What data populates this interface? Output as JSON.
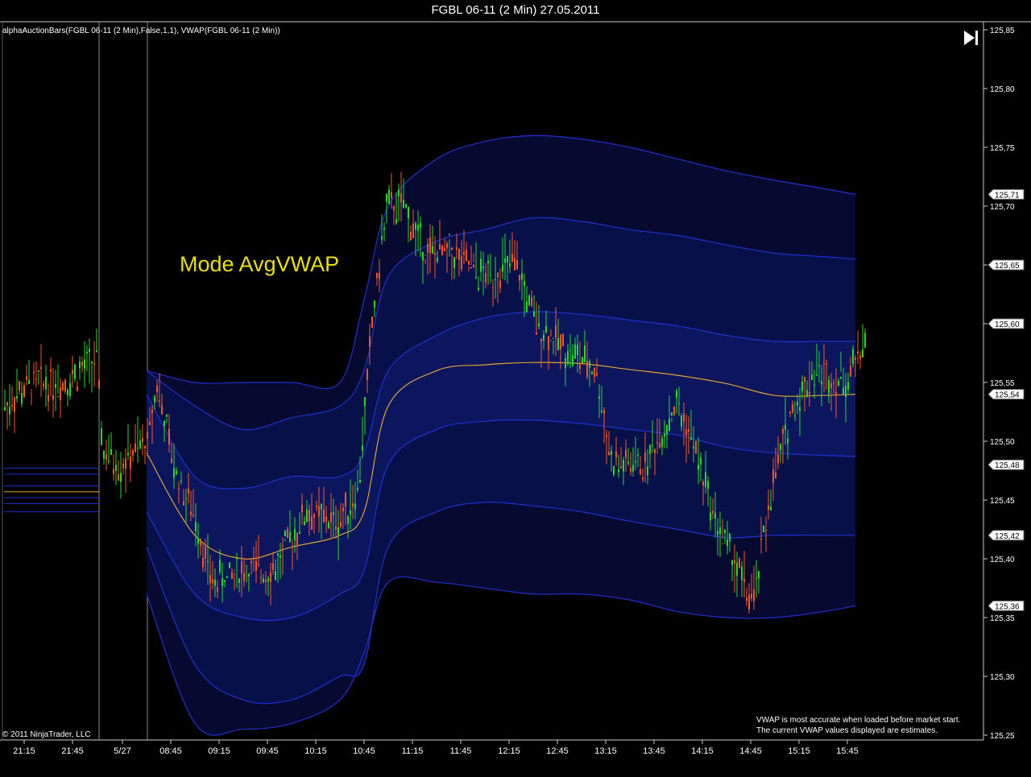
{
  "window": {
    "title": "FGBL 06-11 (2 Min)  27.05.2011",
    "indicator_label": "alphaAuctionBars(FGBL 06-11 (2 Min),False,1,1), VWAP(FGBL 06-11 (2 Min))",
    "annotation": "Mode AvgVWAP",
    "copyright": "© 2011 NinjaTrader, LLC",
    "notice_line1": "VWAP is most accurate when loaded before market start.",
    "notice_line2": "The current VWAP values displayed are estimates.",
    "play_icon": "skip-to-end-icon"
  },
  "colors": {
    "background": "#000000",
    "annotation": "#e8e000",
    "vwap": "#e0a030",
    "band": "#2030d0",
    "up_bar": "#22dd22",
    "down_bar": "#ff5522",
    "neutral_bar": "#ffffff",
    "session_fill": "#0a1060"
  },
  "chart_data": {
    "type": "line",
    "y_axis": {
      "range": [
        125.25,
        125.85
      ],
      "ticks": [
        "125,85",
        "125,80",
        "125,75",
        "125,70",
        "125,65",
        "125,60",
        "125,55",
        "125,50",
        "125,45",
        "125,40",
        "125,35",
        "125,30",
        "125,25"
      ]
    },
    "x_axis": {
      "ticks": [
        "21:15",
        "21:45",
        "5/27",
        "08:45",
        "09:15",
        "09:45",
        "10:15",
        "10:45",
        "11:15",
        "11:45",
        "12:15",
        "12:45",
        "13:15",
        "13:45",
        "14:15",
        "14:45",
        "15:15",
        "15:45"
      ]
    },
    "price_flags": [
      {
        "label": "125,71",
        "value": 125.71
      },
      {
        "label": "125,65",
        "value": 125.65
      },
      {
        "label": "125,60",
        "value": 125.6
      },
      {
        "label": "125,54",
        "value": 125.54
      },
      {
        "label": "125,48",
        "value": 125.48
      },
      {
        "label": "125,42",
        "value": 125.42
      },
      {
        "label": "125,36",
        "value": 125.36
      }
    ],
    "series": [
      {
        "name": "VWAP",
        "x": [
          "08:30",
          "09:00",
          "09:30",
          "10:00",
          "10:30",
          "10:45",
          "11:00",
          "11:30",
          "12:00",
          "12:30",
          "13:00",
          "13:30",
          "14:00",
          "14:30",
          "15:00",
          "15:30",
          "15:50"
        ],
        "values": [
          125.49,
          125.42,
          125.4,
          125.41,
          125.42,
          125.44,
          125.53,
          125.56,
          125.565,
          125.567,
          125.566,
          125.561,
          125.556,
          125.549,
          125.539,
          125.539,
          125.54
        ]
      },
      {
        "x": [
          "08:30",
          "09:00",
          "09:30",
          "10:00",
          "10:30",
          "10:45",
          "11:00",
          "11:30",
          "12:00",
          "12:30",
          "13:00",
          "13:30",
          "14:00",
          "14:30",
          "15:00",
          "15:30",
          "15:50"
        ],
        "values": [
          125.54,
          125.47,
          125.46,
          125.47,
          125.47,
          125.49,
          125.56,
          125.59,
          125.605,
          125.61,
          125.608,
          125.603,
          125.598,
          125.59,
          125.585,
          125.585,
          125.585
        ]
      },
      {
        "x": [
          "08:30",
          "09:00",
          "09:30",
          "10:00",
          "10:30",
          "10:45",
          "11:00",
          "11:30",
          "12:00",
          "12:30",
          "13:00",
          "13:30",
          "14:00",
          "14:30",
          "15:00",
          "15:30",
          "15:50"
        ],
        "values": [
          125.44,
          125.37,
          125.35,
          125.35,
          125.37,
          125.39,
          125.48,
          125.51,
          125.517,
          125.518,
          125.515,
          125.51,
          125.505,
          125.495,
          125.49,
          125.488,
          125.487
        ]
      },
      {
        "x": [
          "08:30",
          "09:00",
          "09:30",
          "10:00",
          "10:30",
          "10:45",
          "11:00",
          "11:30",
          "12:00",
          "12:30",
          "13:00",
          "13:30",
          "14:00",
          "14:30",
          "15:00",
          "15:30",
          "15:50"
        ],
        "values": [
          125.56,
          125.53,
          125.51,
          125.52,
          125.53,
          125.56,
          125.64,
          125.67,
          125.68,
          125.69,
          125.687,
          125.68,
          125.675,
          125.667,
          125.66,
          125.657,
          125.655
        ]
      },
      {
        "x": [
          "08:30",
          "09:00",
          "09:30",
          "10:00",
          "10:30",
          "10:45",
          "11:00",
          "11:30",
          "12:00",
          "12:30",
          "13:00",
          "13:30",
          "14:00",
          "14:30",
          "15:00",
          "15:30",
          "15:50"
        ],
        "values": [
          125.41,
          125.31,
          125.28,
          125.28,
          125.3,
          125.31,
          125.41,
          125.44,
          125.448,
          125.445,
          125.44,
          125.432,
          125.425,
          125.418,
          125.42,
          125.42,
          125.42
        ]
      },
      {
        "x": [
          "08:30",
          "09:00",
          "09:30",
          "10:00",
          "10:30",
          "10:45",
          "11:00",
          "11:30",
          "12:00",
          "12:30",
          "13:00",
          "13:30",
          "14:00",
          "14:30",
          "15:00",
          "15:30",
          "15:50"
        ],
        "values": [
          125.56,
          125.55,
          125.55,
          125.55,
          125.55,
          125.62,
          125.7,
          125.74,
          125.755,
          125.76,
          125.757,
          125.75,
          125.74,
          125.73,
          125.722,
          125.715,
          125.71
        ]
      },
      {
        "x": [
          "08:30",
          "09:00",
          "09:30",
          "10:00",
          "10:30",
          "10:45",
          "11:00",
          "11:30",
          "12:00",
          "12:30",
          "13:00",
          "13:30",
          "14:00",
          "14:30",
          "15:00",
          "15:30",
          "15:50"
        ],
        "values": [
          125.37,
          125.26,
          125.255,
          125.26,
          125.28,
          125.32,
          125.38,
          125.38,
          125.375,
          125.37,
          125.37,
          125.365,
          125.355,
          125.35,
          125.35,
          125.355,
          125.36
        ]
      }
    ]
  }
}
